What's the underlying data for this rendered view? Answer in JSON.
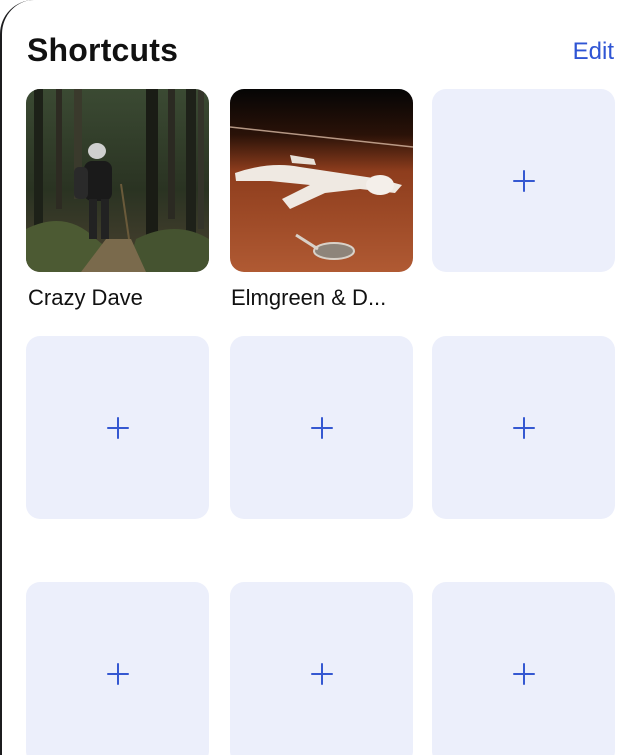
{
  "header": {
    "title": "Shortcuts",
    "edit_label": "Edit"
  },
  "shortcuts": [
    {
      "label": "Crazy Dave",
      "image": "forest-hiker-photo"
    },
    {
      "label": "Elmgreen & D...",
      "image": "statue-on-tennis-court-photo"
    }
  ],
  "empty_slots": 7,
  "colors": {
    "accent": "#2f55d4",
    "tile_background": "#eceffb",
    "text": "#111111"
  }
}
